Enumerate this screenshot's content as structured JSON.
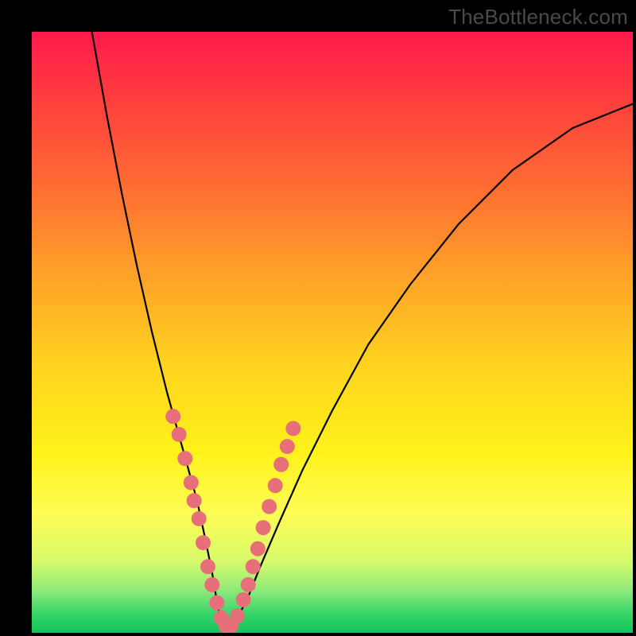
{
  "watermark": "TheBottleneck.com",
  "chart_data": {
    "type": "line",
    "title": "",
    "xlabel": "",
    "ylabel": "",
    "xlim": [
      0,
      100
    ],
    "ylim": [
      0,
      100
    ],
    "note": "V-shaped bottleneck curve over a vertical green-yellow-red gradient. No numeric axes are visible; a cluster of pink dots sits near the trough of the V in the lower third.",
    "series": [
      {
        "name": "curve",
        "x": [
          10,
          12.5,
          15,
          17.5,
          20,
          22.5,
          25,
          27.5,
          29,
          30,
          31,
          32,
          33,
          34,
          36,
          38,
          41,
          45,
          50,
          56,
          63,
          71,
          80,
          90,
          100
        ],
        "y": [
          100,
          86,
          73,
          61,
          50,
          40,
          31,
          22,
          15,
          10,
          4,
          1,
          1,
          2,
          6,
          11,
          18,
          27,
          37,
          48,
          58,
          68,
          77,
          84,
          88
        ]
      }
    ],
    "dots": {
      "name": "markers",
      "color": "#e76f7a",
      "points": [
        {
          "x": 23.5,
          "y": 36
        },
        {
          "x": 24.5,
          "y": 33
        },
        {
          "x": 25.5,
          "y": 29
        },
        {
          "x": 26.5,
          "y": 25
        },
        {
          "x": 27.0,
          "y": 22
        },
        {
          "x": 27.8,
          "y": 19
        },
        {
          "x": 28.5,
          "y": 15
        },
        {
          "x": 29.3,
          "y": 11
        },
        {
          "x": 30.0,
          "y": 8
        },
        {
          "x": 30.8,
          "y": 5
        },
        {
          "x": 31.5,
          "y": 2.5
        },
        {
          "x": 32.3,
          "y": 1.2
        },
        {
          "x": 33.2,
          "y": 1.2
        },
        {
          "x": 34.2,
          "y": 2.8
        },
        {
          "x": 35.2,
          "y": 5.5
        },
        {
          "x": 36.0,
          "y": 8
        },
        {
          "x": 36.8,
          "y": 11
        },
        {
          "x": 37.6,
          "y": 14
        },
        {
          "x": 38.5,
          "y": 17.5
        },
        {
          "x": 39.5,
          "y": 21
        },
        {
          "x": 40.5,
          "y": 24.5
        },
        {
          "x": 41.5,
          "y": 28
        },
        {
          "x": 42.5,
          "y": 31
        },
        {
          "x": 43.5,
          "y": 34
        }
      ]
    }
  }
}
